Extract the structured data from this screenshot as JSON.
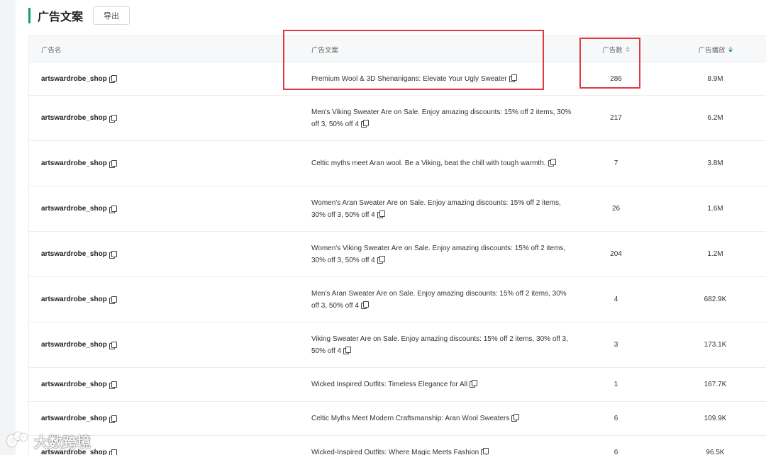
{
  "header": {
    "title": "广告文案",
    "export_label": "导出"
  },
  "table": {
    "columns": {
      "name": "广告名",
      "copy": "广告文案",
      "count": "广告数",
      "play": "广告播放"
    },
    "rows": [
      {
        "name": "artswardrobe_shop",
        "copy": "Premium Wool & 3D Shenanigans: Elevate Your Ugly Sweater",
        "count": "286",
        "play": "8.9M"
      },
      {
        "name": "artswardrobe_shop",
        "copy": "Men's Viking Sweater Are on Sale. Enjoy amazing discounts: 15% off 2 items, 30% off 3, 50% off 4",
        "count": "217",
        "play": "6.2M"
      },
      {
        "name": "artswardrobe_shop",
        "copy": "Celtic myths meet Aran wool. Be a Viking, beat the chill with tough warmth.",
        "count": "7",
        "play": "3.8M"
      },
      {
        "name": "artswardrobe_shop",
        "copy": "Women's Aran Sweater Are on Sale. Enjoy amazing discounts: 15% off 2 items, 30% off 3, 50% off 4",
        "count": "26",
        "play": "1.6M"
      },
      {
        "name": "artswardrobe_shop",
        "copy": "Women's Viking Sweater Are on Sale. Enjoy amazing discounts: 15% off 2 items, 30% off 3, 50% off 4",
        "count": "204",
        "play": "1.2M"
      },
      {
        "name": "artswardrobe_shop",
        "copy": "Men's Aran Sweater Are on Sale. Enjoy amazing discounts: 15% off 2 items, 30% off 3, 50% off 4",
        "count": "4",
        "play": "682.9K"
      },
      {
        "name": "artswardrobe_shop",
        "copy": "Viking Sweater Are on Sale. Enjoy amazing discounts: 15% off 2 items, 30% off 3, 50% off 4",
        "count": "3",
        "play": "173.1K"
      },
      {
        "name": "artswardrobe_shop",
        "copy": "Wicked Inspired Outfits: Timeless Elegance for All",
        "count": "1",
        "play": "167.7K"
      },
      {
        "name": "artswardrobe_shop",
        "copy": "Celtic Myths Meet Modern Craftsmanship: Aran Wool Sweaters",
        "count": "6",
        "play": "109.9K"
      },
      {
        "name": "artswardrobe_shop",
        "copy": "Wicked-Inspired Outfits: Where Magic Meets Fashion",
        "count": "6",
        "play": "96.5K"
      }
    ]
  },
  "watermark": {
    "text": "大数跨境"
  },
  "colors": {
    "accent": "#0f9d7a",
    "highlight": "#e0393e"
  }
}
